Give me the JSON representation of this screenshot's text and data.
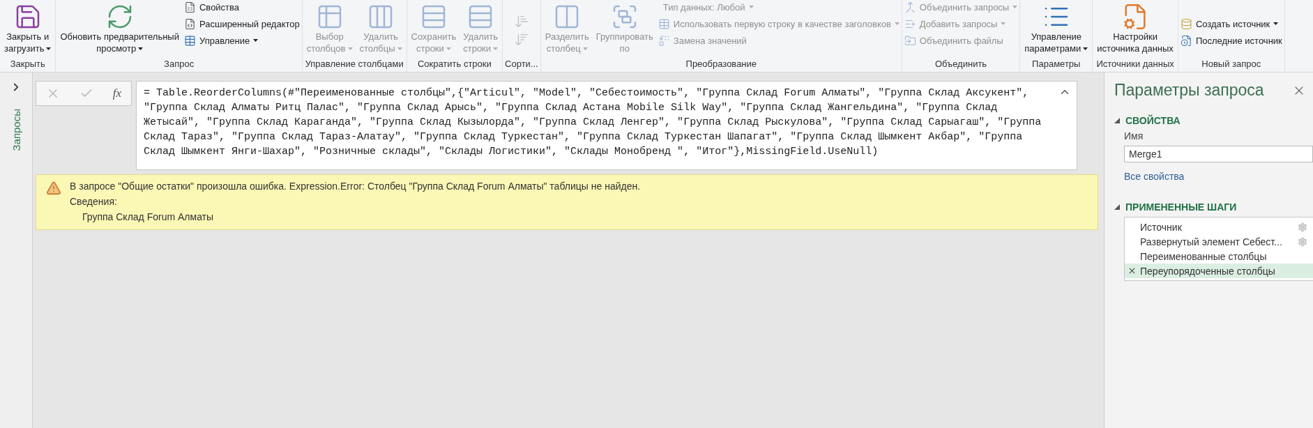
{
  "ribbon": {
    "groups": [
      {
        "label": "Закрыть",
        "items": [
          {
            "kind": "large",
            "lines": [
              "Закрыть и",
              "загрузить"
            ],
            "caret": true,
            "disabled": false
          }
        ]
      },
      {
        "label": "Запрос",
        "items": [
          {
            "kind": "large",
            "lines": [
              "Обновить предварительный",
              "просмотр"
            ],
            "caret": true,
            "disabled": false
          },
          {
            "kind": "stack",
            "entries": [
              {
                "label": "Свойства",
                "caret": false,
                "disabled": false
              },
              {
                "label": "Расширенный редактор",
                "caret": false,
                "disabled": false
              },
              {
                "label": "Управление",
                "caret": true,
                "disabled": false
              }
            ]
          }
        ]
      },
      {
        "label": "Управление столбцами",
        "items": [
          {
            "kind": "large",
            "lines": [
              "Выбор",
              "столбцов"
            ],
            "caret": true,
            "disabled": true
          },
          {
            "kind": "large",
            "lines": [
              "Удалить",
              "столбцы"
            ],
            "caret": true,
            "disabled": true
          }
        ]
      },
      {
        "label": "Сократить строки",
        "items": [
          {
            "kind": "large",
            "lines": [
              "Сохранить",
              "строки"
            ],
            "caret": true,
            "disabled": true
          },
          {
            "kind": "large",
            "lines": [
              "Удалить",
              "строки"
            ],
            "caret": true,
            "disabled": true
          }
        ]
      },
      {
        "label": "Сорти...",
        "items": [
          {
            "kind": "icons",
            "entries": [
              {
                "disabled": true
              },
              {
                "disabled": true
              }
            ]
          }
        ]
      },
      {
        "label": "Преобразование",
        "items": [
          {
            "kind": "large",
            "lines": [
              "Разделить",
              "столбец"
            ],
            "caret": true,
            "disabled": true
          },
          {
            "kind": "large",
            "lines": [
              "Группировать",
              "по"
            ],
            "caret": false,
            "disabled": true
          },
          {
            "kind": "stack",
            "entries": [
              {
                "label": "Тип данных: Любой",
                "caret": true,
                "disabled": true
              },
              {
                "label": "Использовать первую строку в качестве заголовков",
                "caret": true,
                "disabled": true
              },
              {
                "label": "Замена значений",
                "caret": false,
                "disabled": true
              }
            ]
          }
        ]
      },
      {
        "label": "Объединить",
        "items": [
          {
            "kind": "stack",
            "entries": [
              {
                "label": "Объединить запросы",
                "caret": true,
                "disabled": true
              },
              {
                "label": "Добавить запросы",
                "caret": true,
                "disabled": true
              },
              {
                "label": "Объединить файлы",
                "caret": false,
                "disabled": true
              }
            ]
          }
        ]
      },
      {
        "label": "Параметры",
        "items": [
          {
            "kind": "large",
            "lines": [
              "Управление",
              "параметрами"
            ],
            "caret": true,
            "disabled": false
          }
        ]
      },
      {
        "label": "Источники данных",
        "items": [
          {
            "kind": "large",
            "lines": [
              "Настройки",
              "источника данных"
            ],
            "caret": false,
            "disabled": false
          }
        ]
      },
      {
        "label": "Новый запрос",
        "items": [
          {
            "kind": "stack",
            "entries": [
              {
                "label": "Создать источник",
                "caret": true,
                "disabled": false
              },
              {
                "label": "Последние источник",
                "caret": false,
                "disabled": false
              }
            ]
          }
        ]
      }
    ]
  },
  "queries_pane": {
    "title": "Запросы",
    "expanded": false
  },
  "formula_bar": {
    "fx_label": "fx",
    "formula": "= Table.ReorderColumns(#\"Переименованные столбцы\",{\"Articul\", \"Model\", \"Себестоимость\", \"Группа Склад Forum Алматы\", \"Группа Склад Аксукент\", \"Группа Склад Алматы Ритц Палас\", \"Группа Склад Арысь\", \"Группа Склад Астана Mobile Silk Way\", \"Группа Склад Жангельдина\", \"Группа Склад Жетысай\", \"Группа Склад Караганда\", \"Группа Склад Кызылорда\", \"Группа Склад Ленгер\", \"Группа Склад Рыскулова\", \"Группа Склад Сарыагаш\", \"Группа Склад Тараз\", \"Группа Склад Тараз-Алатау\", \"Группа Склад Туркестан\", \"Группа Склад Туркестан Шапагат\", \"Группа Склад Шымкент Акбар\", \"Группа Склад Шымкент Янги-Шахар\", \"Розничные склады\", \"Склады Логистики\", \"Склады Монобренд \", \"Итог\"},MissingField.UseNull)",
    "expanded": true
  },
  "error": {
    "message": "В запросе \"Общие остатки\" произошла ошибка. Expression.Error: Столбец \"Группа Склад Forum Алматы\" таблицы не найден.",
    "details_label": "Сведения:",
    "detail": "Группа Склад Forum Алматы"
  },
  "query_settings": {
    "title": "Параметры запроса",
    "properties": {
      "heading": "СВОЙСТВА",
      "expanded": true,
      "name_label": "Имя",
      "name_value": "Merge1",
      "all_properties_link": "Все свойства"
    },
    "steps": {
      "heading": "ПРИМЕНЕННЫЕ ШАГИ",
      "expanded": true,
      "items": [
        {
          "label": "Источник",
          "settings": true,
          "selected": false
        },
        {
          "label": "Развернутый элемент Себест...",
          "settings": true,
          "selected": false
        },
        {
          "label": "Переименованные столбцы",
          "settings": false,
          "selected": false
        },
        {
          "label": "Переупорядоченные столбцы",
          "settings": false,
          "selected": true
        }
      ]
    }
  }
}
